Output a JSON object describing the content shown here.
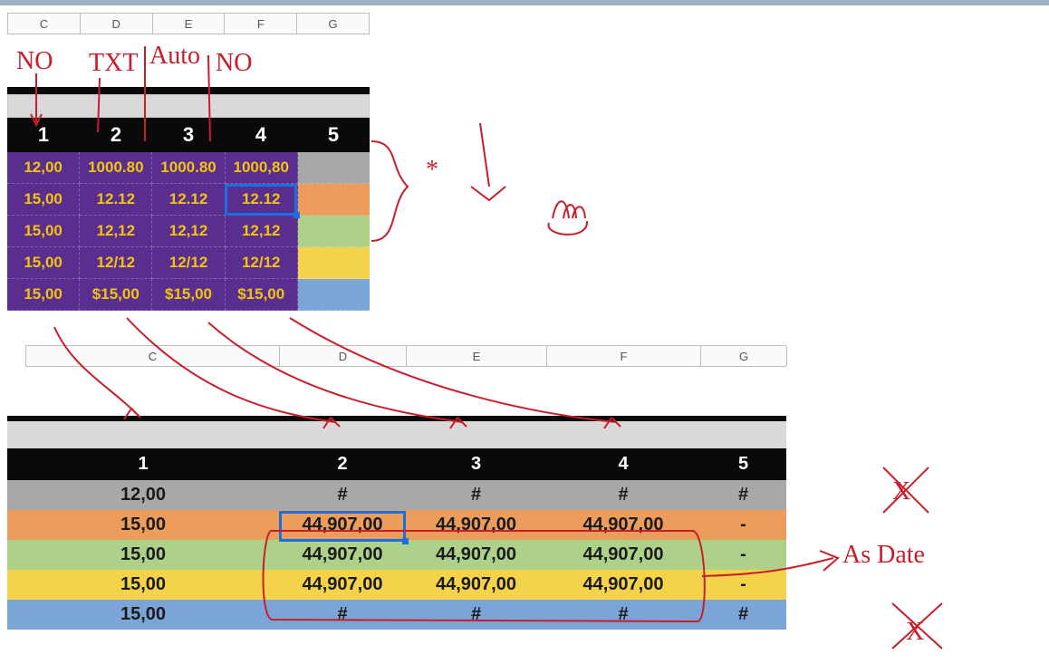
{
  "upper": {
    "columns": [
      "C",
      "D",
      "E",
      "F",
      "G"
    ],
    "headers": [
      "1",
      "2",
      "3",
      "4",
      "5"
    ],
    "rows": [
      {
        "band": "gray",
        "cells": [
          "12,00",
          "1000.80",
          "1000.80",
          "1000,80",
          ""
        ]
      },
      {
        "band": "orange",
        "cells": [
          "15,00",
          "12.12",
          "12.12",
          "12.12",
          ""
        ]
      },
      {
        "band": "green",
        "cells": [
          "15,00",
          "12,12",
          "12,12",
          "12,12",
          ""
        ]
      },
      {
        "band": "yellow",
        "cells": [
          "15,00",
          "12/12",
          "12/12",
          "12/12",
          ""
        ]
      },
      {
        "band": "blue",
        "cells": [
          "15,00",
          "$15,00",
          "$15,00",
          "$15,00",
          ""
        ]
      }
    ],
    "selected": {
      "row": 1,
      "col": 3
    }
  },
  "lower": {
    "columns": [
      "C",
      "D",
      "E",
      "F",
      "G"
    ],
    "headers": [
      "1",
      "2",
      "3",
      "4",
      "5"
    ],
    "rows": [
      {
        "band": "gray",
        "cells": [
          "12,00",
          "#",
          "#",
          "#",
          "#"
        ]
      },
      {
        "band": "orange",
        "cells": [
          "15,00",
          "44,907,00",
          "44,907,00",
          "44,907,00",
          "-"
        ]
      },
      {
        "band": "green",
        "cells": [
          "15,00",
          "44,907,00",
          "44,907,00",
          "44,907,00",
          "-"
        ]
      },
      {
        "band": "yellow",
        "cells": [
          "15,00",
          "44,907,00",
          "44,907,00",
          "44,907,00",
          "-"
        ]
      },
      {
        "band": "blue",
        "cells": [
          "15,00",
          "#",
          "#",
          "#",
          "#"
        ]
      }
    ],
    "selected": {
      "row": 1,
      "col": 1
    }
  },
  "annotations": {
    "label_c": "NO",
    "label_d": "TXT",
    "label_e": "Auto",
    "label_f": "NO",
    "star": "*",
    "as_date": "As Date",
    "x": "X"
  }
}
